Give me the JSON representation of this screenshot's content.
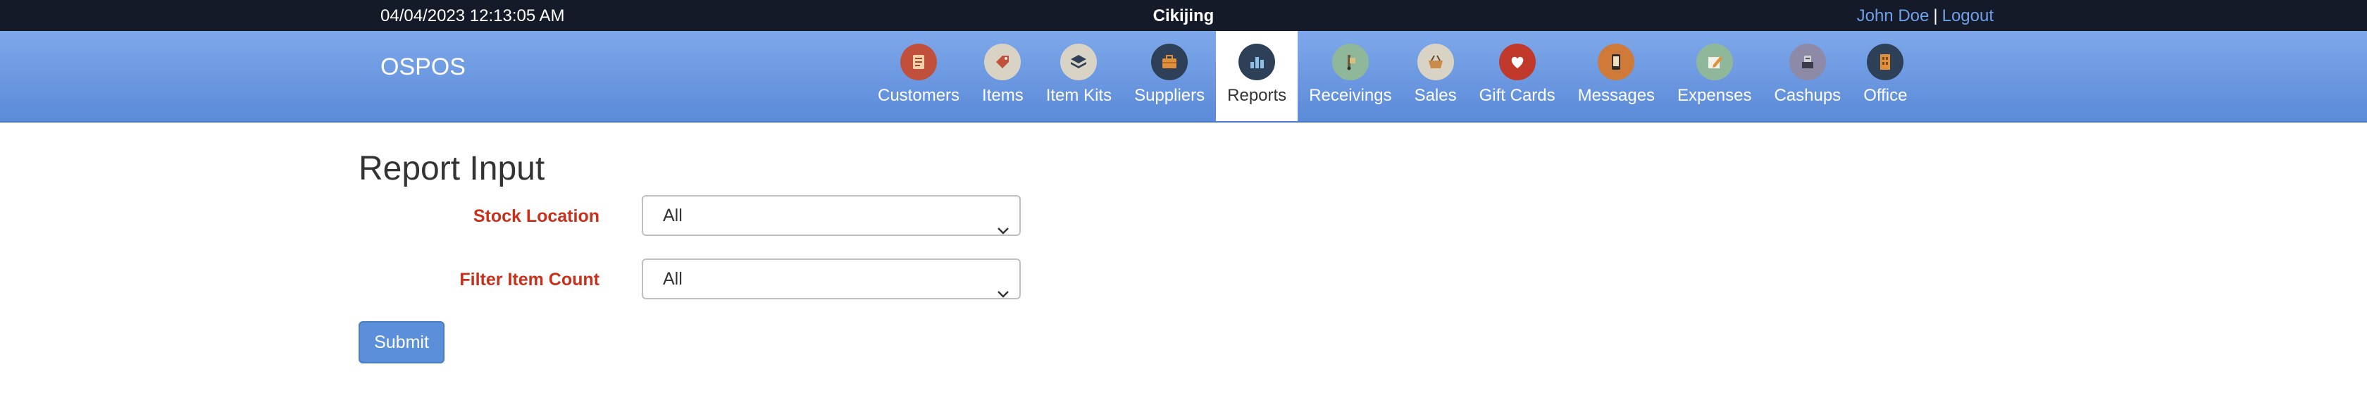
{
  "topbar": {
    "datetime": "04/04/2023 12:13:05 AM",
    "company": "Cikijing",
    "user_name": "John Doe",
    "separator": "|",
    "logout_label": "Logout"
  },
  "brand": "OSPOS",
  "nav": [
    {
      "label": "Customers",
      "icon": "customers-icon",
      "color": "#c0503b"
    },
    {
      "label": "Items",
      "icon": "items-icon",
      "color": "#d9d3c6"
    },
    {
      "label": "Item Kits",
      "icon": "item-kits-icon",
      "color": "#d9d3c6"
    },
    {
      "label": "Suppliers",
      "icon": "suppliers-icon",
      "color": "#2e4057"
    },
    {
      "label": "Reports",
      "icon": "reports-icon",
      "color": "#2e4057",
      "active": true
    },
    {
      "label": "Receivings",
      "icon": "receivings-icon",
      "color": "#8fb89a"
    },
    {
      "label": "Sales",
      "icon": "sales-icon",
      "color": "#d9d3c6"
    },
    {
      "label": "Gift Cards",
      "icon": "gift-cards-icon",
      "color": "#c0392b"
    },
    {
      "label": "Messages",
      "icon": "messages-icon",
      "color": "#d07a3a"
    },
    {
      "label": "Expenses",
      "icon": "expenses-icon",
      "color": "#8fb89a"
    },
    {
      "label": "Cashups",
      "icon": "cashups-icon",
      "color": "#8d8aa8"
    },
    {
      "label": "Office",
      "icon": "office-icon",
      "color": "#2e4057"
    }
  ],
  "page": {
    "title": "Report Input"
  },
  "form": {
    "stock_location": {
      "label": "Stock Location",
      "value": "All"
    },
    "filter_item_count": {
      "label": "Filter Item Count",
      "value": "All"
    },
    "submit_label": "Submit"
  }
}
